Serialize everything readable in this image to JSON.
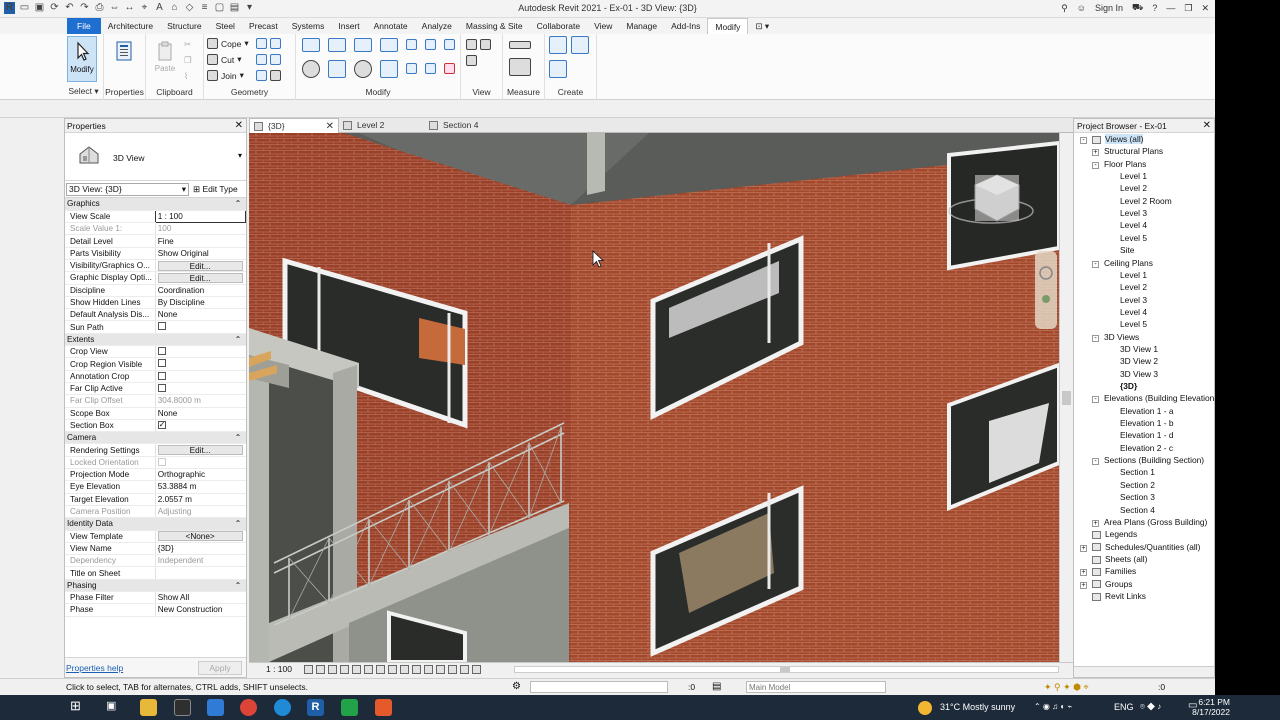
{
  "app": {
    "title": "Autodesk Revit 2021 - Ex-01 - 3D View: {3D}",
    "sign_in": "Sign In"
  },
  "ribbon_tabs": [
    "File",
    "Architecture",
    "Structure",
    "Steel",
    "Precast",
    "Systems",
    "Insert",
    "Annotate",
    "Analyze",
    "Massing & Site",
    "Collaborate",
    "View",
    "Manage",
    "Add-Ins",
    "Modify"
  ],
  "ribbon": {
    "modify_label": "Modify",
    "select_label": "Select",
    "properties_label": "Properties",
    "paste_label": "Paste",
    "clipboard_label": "Clipboard",
    "cope_label": "Cope",
    "cut_label": "Cut",
    "join_label": "Join",
    "geometry_label": "Geometry",
    "modify_panel_label": "Modify",
    "view_label": "View",
    "measure_label": "Measure",
    "create_label": "Create"
  },
  "properties": {
    "header": "Properties",
    "type_name": "3D View",
    "filter_value": "3D View: {3D}",
    "edit_type": "Edit Type",
    "rows": [
      {
        "group": "Graphics"
      },
      {
        "k": "View Scale",
        "v": "1 : 100",
        "kind": "input"
      },
      {
        "k": "Scale Value    1:",
        "v": "100",
        "kind": "disabled"
      },
      {
        "k": "Detail Level",
        "v": "Fine"
      },
      {
        "k": "Parts Visibility",
        "v": "Show Original"
      },
      {
        "k": "Visibility/Graphics O...",
        "v": "Edit...",
        "kind": "button"
      },
      {
        "k": "Graphic Display Opti...",
        "v": "Edit...",
        "kind": "button"
      },
      {
        "k": "Discipline",
        "v": "Coordination"
      },
      {
        "k": "Show Hidden Lines",
        "v": "By Discipline"
      },
      {
        "k": "Default Analysis Dis...",
        "v": "None"
      },
      {
        "k": "Sun Path",
        "v": "",
        "kind": "check",
        "checked": false
      },
      {
        "group": "Extents"
      },
      {
        "k": "Crop View",
        "v": "",
        "kind": "check",
        "checked": false
      },
      {
        "k": "Crop Region Visible",
        "v": "",
        "kind": "check",
        "checked": false
      },
      {
        "k": "Annotation Crop",
        "v": "",
        "kind": "check",
        "checked": false
      },
      {
        "k": "Far Clip Active",
        "v": "",
        "kind": "check",
        "checked": false
      },
      {
        "k": "Far Clip Offset",
        "v": "304.8000 m",
        "kind": "disabled"
      },
      {
        "k": "Scope Box",
        "v": "None"
      },
      {
        "k": "Section Box",
        "v": "",
        "kind": "check",
        "checked": true
      },
      {
        "group": "Camera"
      },
      {
        "k": "Rendering Settings",
        "v": "Edit...",
        "kind": "button"
      },
      {
        "k": "Locked Orientation",
        "v": "",
        "kind": "disabledcheck"
      },
      {
        "k": "Projection Mode",
        "v": "Orthographic"
      },
      {
        "k": "Eye Elevation",
        "v": "53.3884 m"
      },
      {
        "k": "Target Elevation",
        "v": "2.0557 m"
      },
      {
        "k": "Camera Position",
        "v": "Adjusting",
        "kind": "disabled"
      },
      {
        "group": "Identity Data"
      },
      {
        "k": "View Template",
        "v": "<None>",
        "kind": "button"
      },
      {
        "k": "View Name",
        "v": "{3D}"
      },
      {
        "k": "Dependency",
        "v": "Independent",
        "kind": "disabled"
      },
      {
        "k": "Title on Sheet",
        "v": ""
      },
      {
        "group": "Phasing"
      },
      {
        "k": "Phase Filter",
        "v": "Show All"
      },
      {
        "k": "Phase",
        "v": "New Construction"
      }
    ],
    "help_link": "Properties help",
    "apply": "Apply"
  },
  "view_tabs": [
    {
      "label": "{3D}",
      "active": true
    },
    {
      "label": "Level 2",
      "active": false
    },
    {
      "label": "Section 4",
      "active": false
    }
  ],
  "view_control": {
    "scale": "1 : 100"
  },
  "project_browser": {
    "header": "Project Browser - Ex-01",
    "items": [
      {
        "label": "Views (all)",
        "lvl": 0,
        "tg": "-"
      },
      {
        "label": "Structural Plans",
        "lvl": 1,
        "tg": "+"
      },
      {
        "label": "Floor Plans",
        "lvl": 1,
        "tg": "-"
      },
      {
        "label": "Level 1",
        "lvl": 2
      },
      {
        "label": "Level 2",
        "lvl": 2
      },
      {
        "label": "Level 2 Room",
        "lvl": 2
      },
      {
        "label": "Level 3",
        "lvl": 2
      },
      {
        "label": "Level 4",
        "lvl": 2
      },
      {
        "label": "Level 5",
        "lvl": 2
      },
      {
        "label": "Site",
        "lvl": 2
      },
      {
        "label": "Ceiling Plans",
        "lvl": 1,
        "tg": "-"
      },
      {
        "label": "Level 1",
        "lvl": 2
      },
      {
        "label": "Level 2",
        "lvl": 2
      },
      {
        "label": "Level 3",
        "lvl": 2
      },
      {
        "label": "Level 4",
        "lvl": 2
      },
      {
        "label": "Level 5",
        "lvl": 2
      },
      {
        "label": "3D Views",
        "lvl": 1,
        "tg": "-"
      },
      {
        "label": "3D View 1",
        "lvl": 2
      },
      {
        "label": "3D View 2",
        "lvl": 2
      },
      {
        "label": "3D View 3",
        "lvl": 2
      },
      {
        "label": "{3D}",
        "lvl": 2,
        "bold": true
      },
      {
        "label": "Elevations (Building Elevation)",
        "lvl": 1,
        "tg": "-"
      },
      {
        "label": "Elevation 1 - a",
        "lvl": 2
      },
      {
        "label": "Elevation 1 - b",
        "lvl": 2
      },
      {
        "label": "Elevation 1 - d",
        "lvl": 2
      },
      {
        "label": "Elevation 2 - c",
        "lvl": 2
      },
      {
        "label": "Sections (Building Section)",
        "lvl": 1,
        "tg": "-"
      },
      {
        "label": "Section 1",
        "lvl": 2
      },
      {
        "label": "Section 2",
        "lvl": 2
      },
      {
        "label": "Section 3",
        "lvl": 2
      },
      {
        "label": "Section 4",
        "lvl": 2
      },
      {
        "label": "Area Plans (Gross Building)",
        "lvl": 1,
        "tg": "+"
      },
      {
        "label": "Legends",
        "lvl": 0,
        "tg": "",
        "icon": true
      },
      {
        "label": "Schedules/Quantities (all)",
        "lvl": 0,
        "tg": "+",
        "icon": true
      },
      {
        "label": "Sheets (all)",
        "lvl": 0,
        "tg": "",
        "icon": true
      },
      {
        "label": "Families",
        "lvl": 0,
        "tg": "+",
        "icon": true
      },
      {
        "label": "Groups",
        "lvl": 0,
        "tg": "+",
        "icon": true
      },
      {
        "label": "Revit Links",
        "lvl": 0,
        "tg": "",
        "icon": true
      }
    ]
  },
  "status": {
    "message": "Click to select, TAB for alternates, CTRL adds, SHIFT unselects.",
    "zero": ":0",
    "model": "Main Model",
    "filter_count": ":0"
  },
  "taskbar": {
    "weather": "31°C  Mostly sunny",
    "lang": "ENG",
    "time": "6:21 PM",
    "date": "8/17/2022"
  },
  "colors": {
    "brick": "#a4482c",
    "accent": "#1f6fd1",
    "tab_active_bg": "#ffffff"
  }
}
